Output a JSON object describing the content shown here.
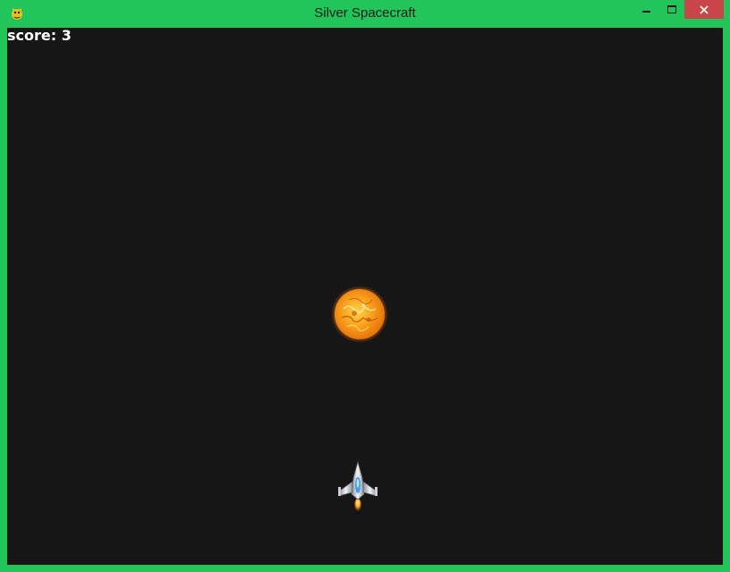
{
  "window": {
    "title": "Silver Spacecraft",
    "app_icon": "pygame-snake-icon",
    "controls": {
      "minimize_icon": "minimize-icon",
      "maximize_icon": "maximize-icon",
      "close_icon": "close-icon"
    },
    "colors": {
      "frame": "#22c55a",
      "close_button": "#c8464a"
    }
  },
  "game": {
    "score_text": "score: 3",
    "background_color": "#161616",
    "sprites": {
      "fireball": "fireball-sun-icon",
      "player_ship": "silver-spaceship-icon"
    }
  }
}
